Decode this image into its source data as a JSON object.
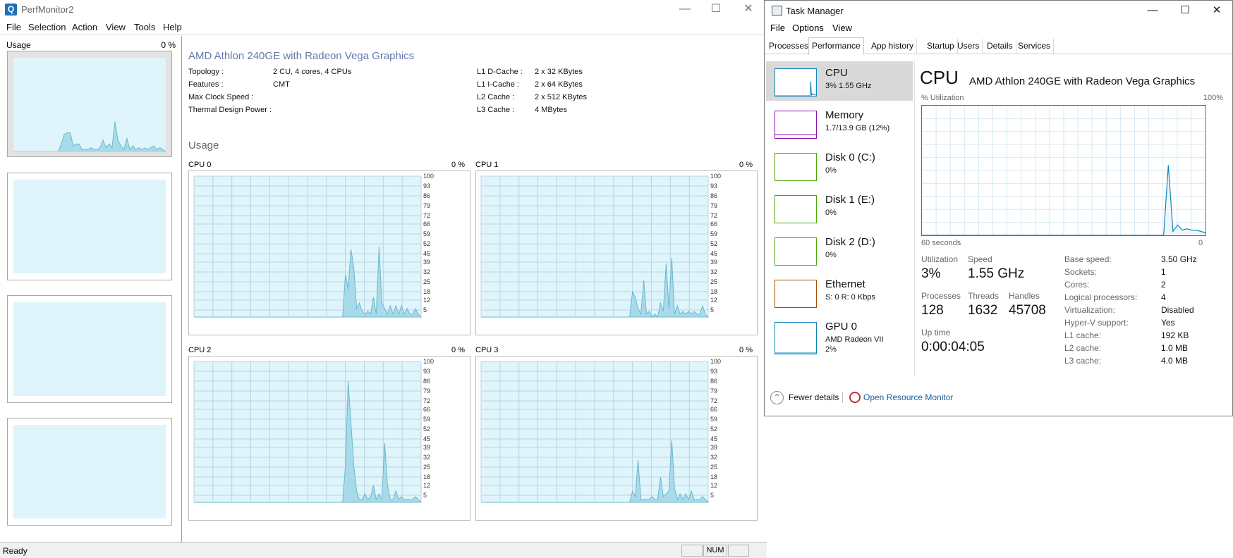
{
  "perfmonitor": {
    "title": "PerfMonitor2",
    "menu": [
      "File",
      "Selection",
      "Action",
      "View",
      "Tools",
      "Help"
    ],
    "left_panel": {
      "label": "Usage",
      "pct": "0 %"
    },
    "cpu_name": "AMD Athlon 240GE with Radeon Vega Graphics",
    "specs_left": [
      {
        "key": "Topology :",
        "value": "2 CU, 4 cores, 4 CPUs"
      },
      {
        "key": "Features :",
        "value": "CMT"
      },
      {
        "key": "Max Clock Speed :",
        "value": ""
      },
      {
        "key": "Thermal Design Power :",
        "value": ""
      }
    ],
    "specs_right": [
      {
        "key": "L1 D-Cache :",
        "value": "2 x 32 KBytes"
      },
      {
        "key": "L1 I-Cache :",
        "value": "2 x 64 KBytes"
      },
      {
        "key": "L2 Cache :",
        "value": "2 x 512 KBytes"
      },
      {
        "key": "L3 Cache :",
        "value": "4 MBytes"
      }
    ],
    "usage_heading": "Usage",
    "y_ticks": [
      "100",
      "93",
      "86",
      "79",
      "72",
      "66",
      "59",
      "52",
      "45",
      "39",
      "32",
      "25",
      "18",
      "12",
      "5"
    ],
    "cpus": [
      {
        "label": "CPU 0",
        "pct": "0 %",
        "series": [
          0,
          0,
          0,
          0,
          0,
          0,
          0,
          0,
          0,
          0,
          0,
          0,
          0,
          0,
          0,
          0,
          0,
          0,
          0,
          0,
          0,
          0,
          0,
          0,
          0,
          0,
          0,
          0,
          0,
          0,
          0,
          0,
          0,
          0,
          0,
          0,
          0,
          0,
          0,
          0,
          0,
          0,
          0,
          0,
          0,
          0,
          0,
          0,
          0,
          0,
          0,
          0,
          0,
          0,
          30,
          20,
          48,
          35,
          6,
          10,
          4,
          2,
          4,
          2,
          14,
          2,
          50,
          10,
          6,
          2,
          8,
          2,
          8,
          2,
          8,
          2,
          6,
          2,
          2,
          6,
          2,
          0
        ]
      },
      {
        "label": "CPU 1",
        "pct": "0 %",
        "series": [
          0,
          0,
          0,
          0,
          0,
          0,
          0,
          0,
          0,
          0,
          0,
          0,
          0,
          0,
          0,
          0,
          0,
          0,
          0,
          0,
          0,
          0,
          0,
          0,
          0,
          0,
          0,
          0,
          0,
          0,
          0,
          0,
          0,
          0,
          0,
          0,
          0,
          0,
          0,
          0,
          0,
          0,
          0,
          0,
          0,
          0,
          0,
          0,
          0,
          0,
          0,
          0,
          0,
          0,
          18,
          14,
          6,
          2,
          26,
          2,
          4,
          0,
          2,
          0,
          10,
          4,
          38,
          6,
          42,
          2,
          8,
          2,
          4,
          2,
          4,
          2,
          4,
          2,
          2,
          8,
          2,
          0
        ]
      },
      {
        "label": "CPU 2",
        "pct": "0 %",
        "series": [
          0,
          0,
          0,
          0,
          0,
          0,
          0,
          0,
          0,
          0,
          0,
          0,
          0,
          0,
          0,
          0,
          0,
          0,
          0,
          0,
          0,
          0,
          0,
          0,
          0,
          0,
          0,
          0,
          0,
          0,
          0,
          0,
          0,
          0,
          0,
          0,
          0,
          0,
          0,
          0,
          0,
          0,
          0,
          0,
          0,
          0,
          0,
          0,
          0,
          0,
          0,
          0,
          0,
          0,
          26,
          86,
          56,
          26,
          8,
          2,
          2,
          6,
          2,
          4,
          12,
          2,
          6,
          2,
          42,
          12,
          2,
          2,
          8,
          2,
          4,
          2,
          2,
          2,
          2,
          4,
          2,
          0
        ]
      },
      {
        "label": "CPU 3",
        "pct": "0 %",
        "series": [
          0,
          0,
          0,
          0,
          0,
          0,
          0,
          0,
          0,
          0,
          0,
          0,
          0,
          0,
          0,
          0,
          0,
          0,
          0,
          0,
          0,
          0,
          0,
          0,
          0,
          0,
          0,
          0,
          0,
          0,
          0,
          0,
          0,
          0,
          0,
          0,
          0,
          0,
          0,
          0,
          0,
          0,
          0,
          0,
          0,
          0,
          0,
          0,
          0,
          0,
          0,
          0,
          0,
          0,
          8,
          4,
          30,
          2,
          2,
          2,
          2,
          4,
          2,
          2,
          18,
          4,
          6,
          8,
          44,
          10,
          2,
          6,
          2,
          6,
          2,
          8,
          2,
          2,
          2,
          4,
          2,
          0
        ]
      }
    ],
    "overview_series": [
      0,
      0,
      0,
      0,
      0,
      0,
      0,
      0,
      0,
      0,
      0,
      0,
      0,
      0,
      0,
      0,
      8,
      18,
      20,
      20,
      6,
      8,
      8,
      2,
      2,
      2,
      4,
      2,
      2,
      4,
      12,
      4,
      8,
      4,
      32,
      12,
      6,
      2,
      14,
      2,
      6,
      2,
      4,
      2,
      4,
      2,
      4,
      6,
      2,
      4,
      2,
      0
    ],
    "status": {
      "ready": "Ready",
      "num": "NUM"
    }
  },
  "taskmanager": {
    "title": "Task Manager",
    "menu": [
      "File",
      "Options",
      "View"
    ],
    "tabs": [
      "Processes",
      "Performance",
      "App history",
      "Startup",
      "Users",
      "Details",
      "Services"
    ],
    "active_tab": "Performance",
    "resources": [
      {
        "name": "CPU",
        "sub": "3% 1.55 GHz",
        "color": "#1185bd"
      },
      {
        "name": "Memory",
        "sub": "1.7/13.9 GB (12%)",
        "color": "#8b12ae"
      },
      {
        "name": "Disk 0 (C:)",
        "sub": "0%",
        "color": "#4da60c"
      },
      {
        "name": "Disk 1 (E:)",
        "sub": "0%",
        "color": "#4da60c"
      },
      {
        "name": "Disk 2 (D:)",
        "sub": "0%",
        "color": "#4da60c"
      },
      {
        "name": "Ethernet",
        "sub": "S: 0 R: 0 Kbps",
        "color": "#a74f01"
      },
      {
        "name": "GPU 0",
        "sub": "AMD Radeon VII",
        "sub2": "2%",
        "color": "#1185bd"
      }
    ],
    "detail": {
      "title": "CPU",
      "subtitle": "AMD Athlon 240GE with Radeon Vega Graphics",
      "util_label": "% Utilization",
      "util_max": "100%",
      "time_left": "60 seconds",
      "time_right": "0",
      "series": [
        0,
        0,
        0,
        0,
        0,
        0,
        0,
        0,
        0,
        0,
        0,
        0,
        0,
        0,
        0,
        0,
        0,
        0,
        0,
        0,
        0,
        0,
        0,
        0,
        0,
        0,
        0,
        0,
        0,
        0,
        0,
        0,
        0,
        0,
        0,
        0,
        0,
        0,
        0,
        0,
        0,
        0,
        0,
        0,
        0,
        0,
        0,
        0,
        0,
        0,
        0,
        0,
        0,
        54,
        3,
        8,
        4,
        5,
        4,
        4,
        3,
        2
      ],
      "stats": {
        "utilization": {
          "label": "Utilization",
          "value": "3%"
        },
        "speed": {
          "label": "Speed",
          "value": "1.55 GHz"
        },
        "processes": {
          "label": "Processes",
          "value": "128"
        },
        "threads": {
          "label": "Threads",
          "value": "1632"
        },
        "handles": {
          "label": "Handles",
          "value": "45708"
        },
        "uptime": {
          "label": "Up time",
          "value": "0:00:04:05"
        }
      },
      "props": [
        {
          "key": "Base speed:",
          "value": "3.50 GHz"
        },
        {
          "key": "Sockets:",
          "value": "1"
        },
        {
          "key": "Cores:",
          "value": "2"
        },
        {
          "key": "Logical processors:",
          "value": "4"
        },
        {
          "key": "Virtualization:",
          "value": "Disabled"
        },
        {
          "key": "Hyper-V support:",
          "value": "Yes"
        },
        {
          "key": "L1 cache:",
          "value": "192 KB"
        },
        {
          "key": "L2 cache:",
          "value": "1.0 MB"
        },
        {
          "key": "L3 cache:",
          "value": "4.0 MB"
        }
      ]
    },
    "footer": {
      "fewer": "Fewer details",
      "resmon": "Open Resource Monitor"
    }
  }
}
